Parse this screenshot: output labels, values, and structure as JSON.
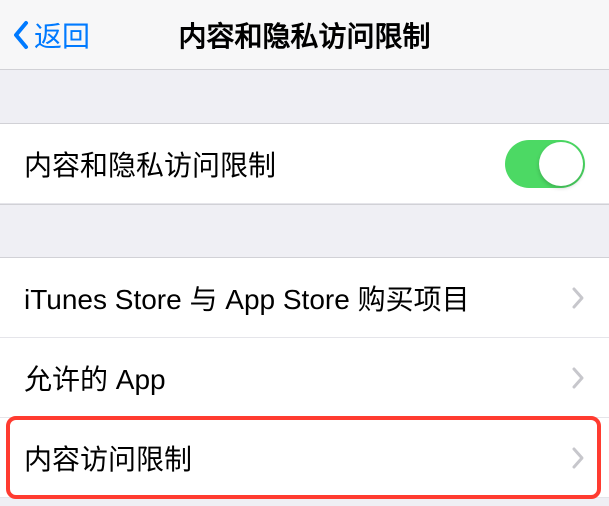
{
  "header": {
    "back_label": "返回",
    "title": "内容和隐私访问限制"
  },
  "toggle_row": {
    "label": "内容和隐私访问限制",
    "enabled": true
  },
  "items": [
    {
      "label": "iTunes Store 与 App Store 购买项目"
    },
    {
      "label": "允许的 App"
    },
    {
      "label": "内容访问限制"
    }
  ]
}
